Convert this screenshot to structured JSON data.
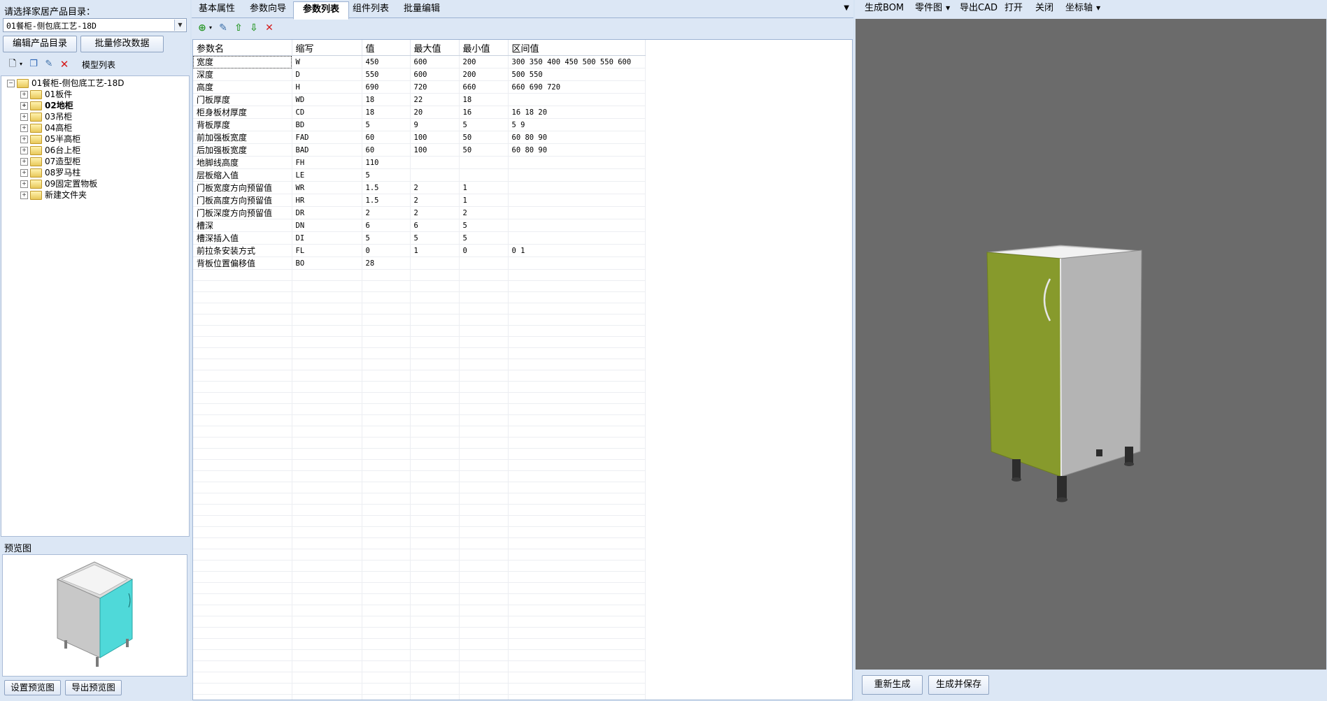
{
  "left": {
    "catalog_label": "请选择家居产品目录：",
    "catalog_value": "01餐柜-侧包底工艺-18D",
    "btn_edit_catalog": "编辑产品目录",
    "btn_batch_modify": "批量修改数据",
    "toolbar_title": "模型列表",
    "tree_root": "01餐柜-侧包底工艺-18D",
    "tree_items": [
      "01板件",
      "02地柜",
      "03吊柜",
      "04高柜",
      "05半高柜",
      "06台上柜",
      "07造型柜",
      "08罗马柱",
      "09固定置物板",
      "新建文件夹"
    ],
    "preview_label": "预览图",
    "btn_set_preview": "设置预览图",
    "btn_export_preview": "导出预览图",
    "preview_door_color": "#4fd9d9"
  },
  "center": {
    "tabs": [
      "基本属性",
      "参数向导",
      "参数列表",
      "组件列表",
      "批量编辑"
    ],
    "active_tab": "参数列表",
    "columns": [
      "参数名",
      "缩写",
      "值",
      "最大值",
      "最小值",
      "区间值"
    ],
    "rows": [
      [
        "宽度",
        "W",
        "450",
        "600",
        "200",
        "300 350 400 450 500 550 600"
      ],
      [
        "深度",
        "D",
        "550",
        "600",
        "200",
        "500 550"
      ],
      [
        "高度",
        "H",
        "690",
        "720",
        "660",
        "660 690 720"
      ],
      [
        "门板厚度",
        "WD",
        "18",
        "22",
        "18",
        ""
      ],
      [
        "柜身板材厚度",
        "CD",
        "18",
        "20",
        "16",
        "16 18 20"
      ],
      [
        "背板厚度",
        "BD",
        "5",
        "9",
        "5",
        "5 9"
      ],
      [
        "前加强板宽度",
        "FAD",
        "60",
        "100",
        "50",
        "60 80 90"
      ],
      [
        "后加强板宽度",
        "BAD",
        "60",
        "100",
        "50",
        "60 80 90"
      ],
      [
        "地脚线高度",
        "FH",
        "110",
        "",
        "",
        ""
      ],
      [
        "层板缩入值",
        "LE",
        "5",
        "",
        "",
        ""
      ],
      [
        "门板宽度方向预留值",
        "WR",
        "1.5",
        "2",
        "1",
        ""
      ],
      [
        "门板高度方向预留值",
        "HR",
        "1.5",
        "2",
        "1",
        ""
      ],
      [
        "门板深度方向预留值",
        "DR",
        "2",
        "2",
        "2",
        ""
      ],
      [
        "槽深",
        "DN",
        "6",
        "6",
        "5",
        ""
      ],
      [
        "槽深插入值",
        "DI",
        "5",
        "5",
        "5",
        ""
      ],
      [
        "前拉条安装方式",
        "FL",
        "0",
        "1",
        "0",
        "0 1"
      ],
      [
        "背板位置偏移值",
        "BO",
        "28",
        "",
        "",
        ""
      ]
    ]
  },
  "right": {
    "toolbar": [
      "生成BOM",
      "零件图",
      "导出CAD",
      "打开",
      "关闭",
      "坐标轴"
    ],
    "btn_regenerate": "重新生成",
    "btn_generate_save": "生成并保存",
    "viewport_bg": "#6b6b6b",
    "door_color": "#879a2c"
  }
}
